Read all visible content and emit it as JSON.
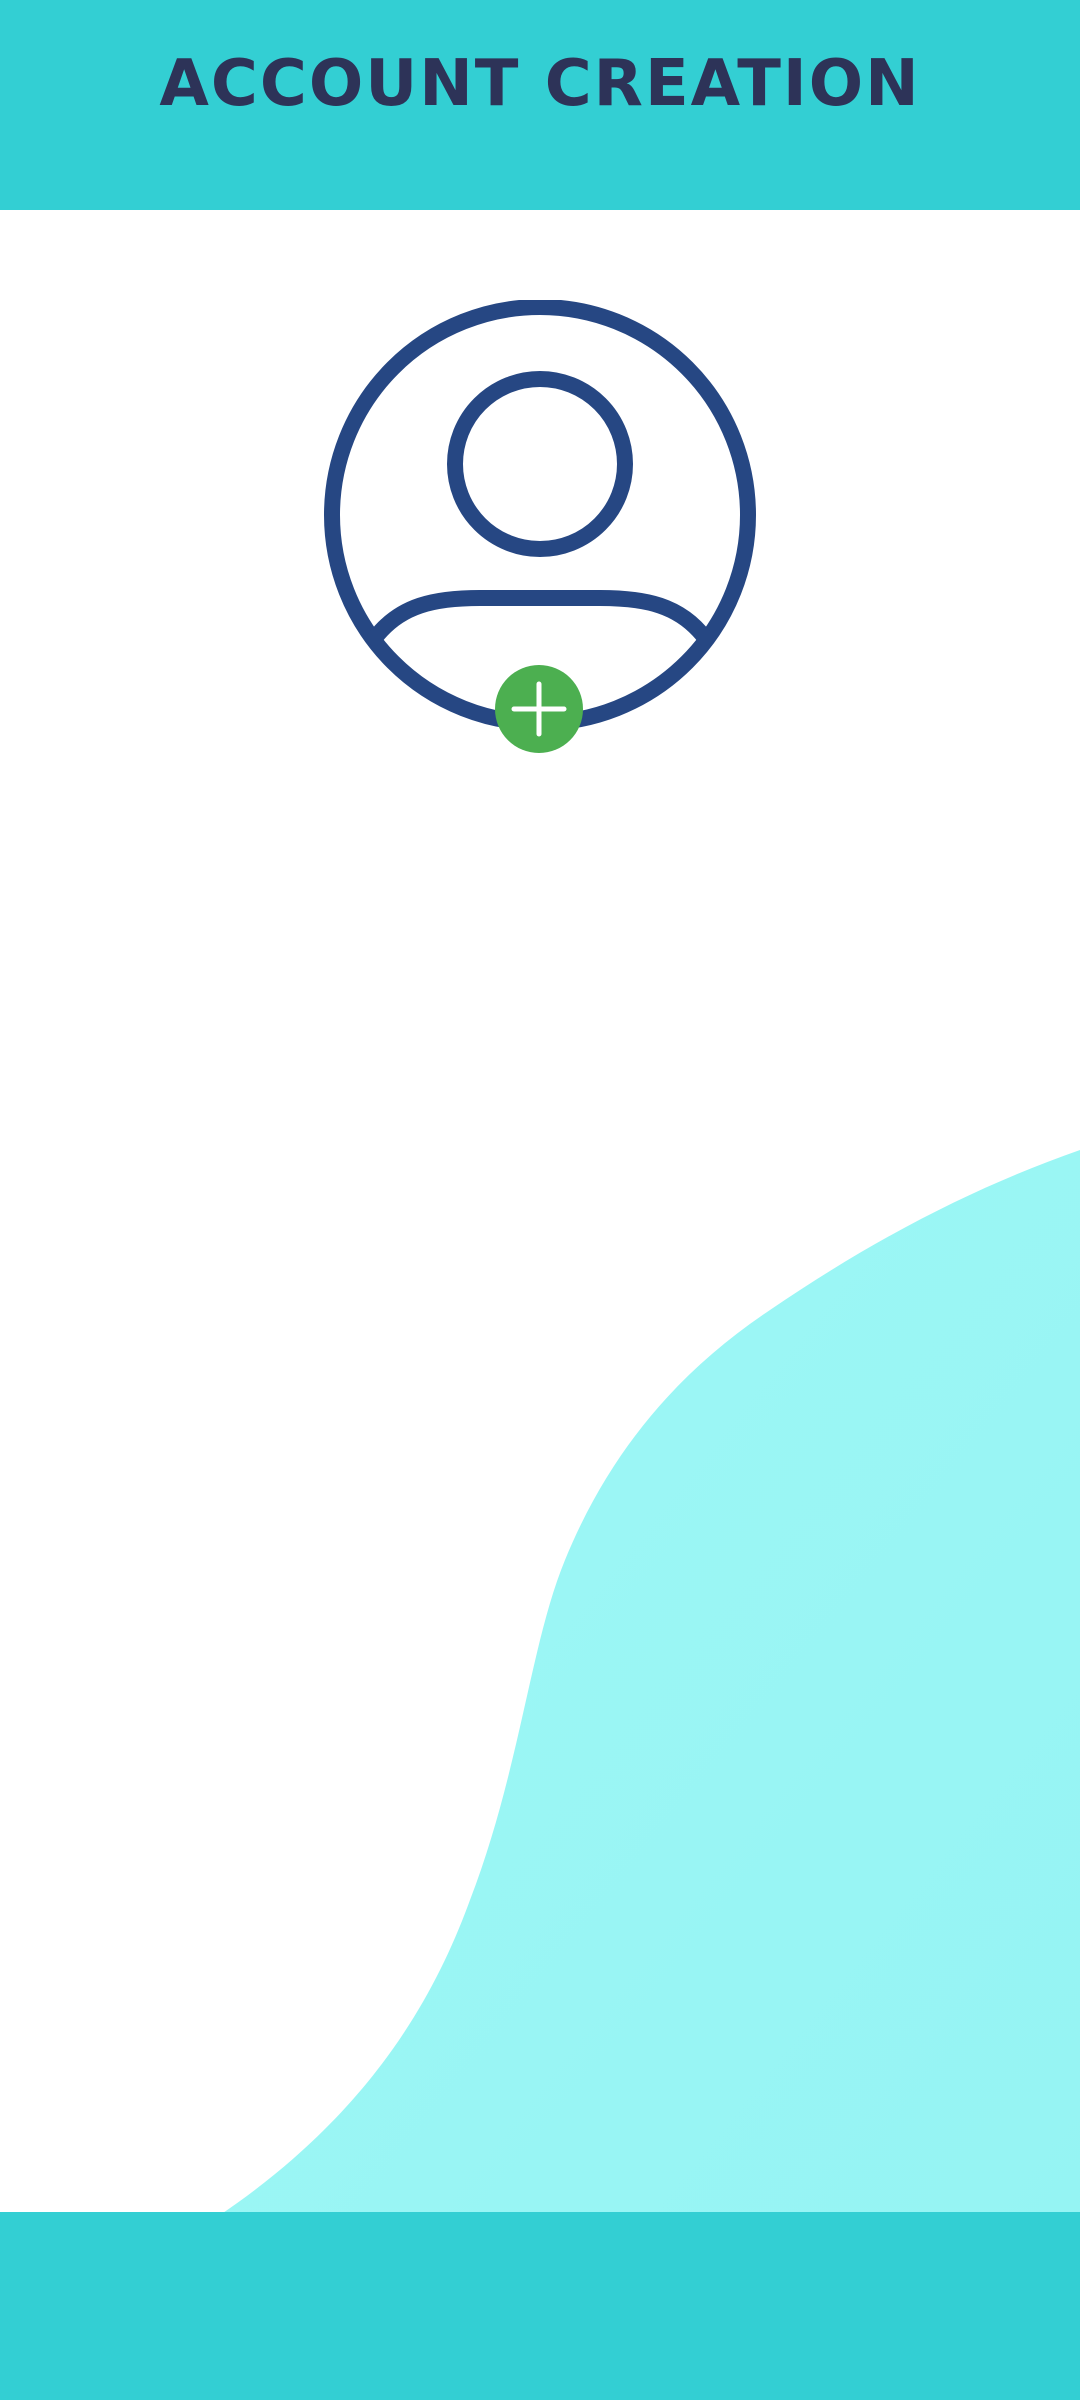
{
  "header": {
    "title": "ACCOUNT CREATION"
  },
  "avatar": {
    "icon": "user-profile-icon",
    "add_icon": "plus-icon"
  },
  "colors": {
    "header_bg": "#33cfd3",
    "footer_bg": "#33cfd3",
    "title_text": "#2d3358",
    "avatar_stroke": "#264783",
    "add_button": "#4caf50",
    "wave": "#9af6f5"
  }
}
